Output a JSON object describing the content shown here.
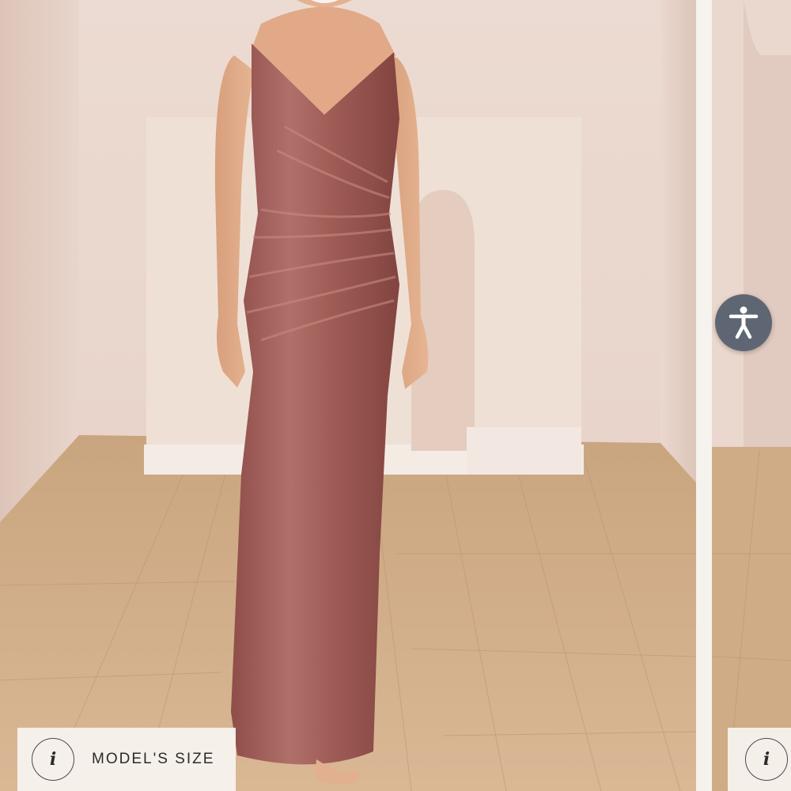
{
  "gallery": {
    "current_slide": {
      "image_alt": "Model wearing a long sleeveless V-neck velvet dress with ruched bodice",
      "dress_color": "#a25f5a",
      "model_size_button": {
        "icon": "info-icon",
        "glyph": "i",
        "label": "MODEL'S SIZE"
      }
    },
    "next_slide": {
      "model_size_button": {
        "icon": "info-icon",
        "glyph": "i"
      }
    }
  },
  "accessibility_button": {
    "icon": "accessibility-person-icon",
    "color": "#5f6673"
  }
}
